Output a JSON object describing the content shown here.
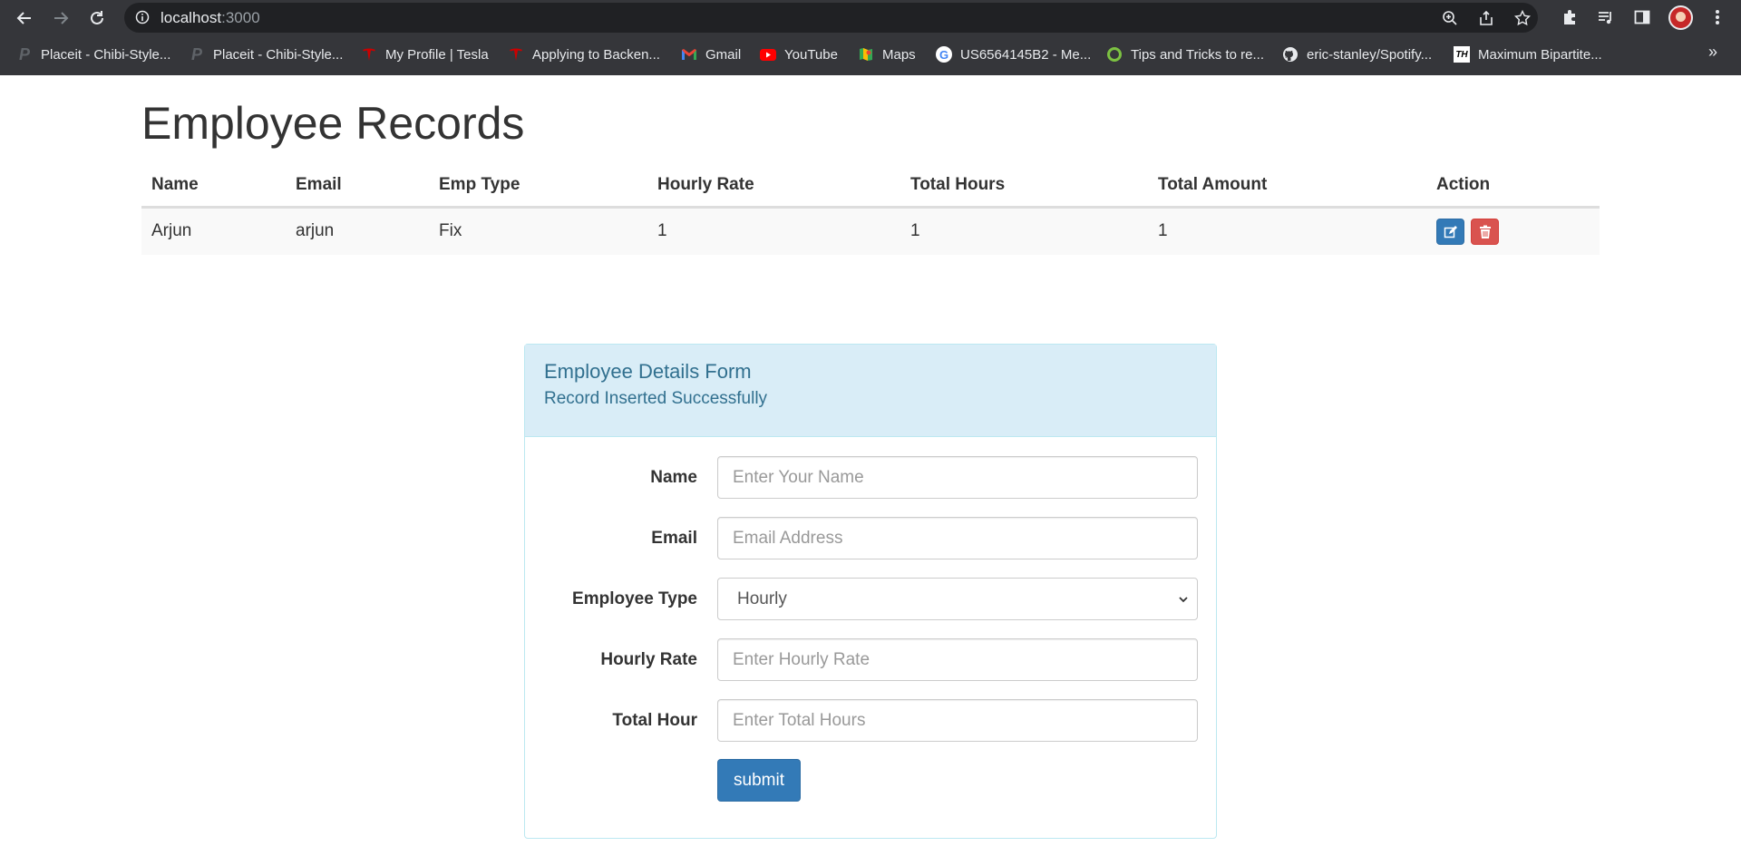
{
  "browser": {
    "url_host": "localhost",
    "url_port": ":3000",
    "bookmarks": [
      {
        "label": "Placeit - Chibi-Style...",
        "icon": "placeit-icon"
      },
      {
        "label": "Placeit - Chibi-Style...",
        "icon": "placeit-icon"
      },
      {
        "label": "My Profile | Tesla",
        "icon": "tesla-icon"
      },
      {
        "label": "Applying to Backen...",
        "icon": "tesla-icon"
      },
      {
        "label": "Gmail",
        "icon": "gmail-icon"
      },
      {
        "label": "YouTube",
        "icon": "youtube-icon"
      },
      {
        "label": "Maps",
        "icon": "maps-icon"
      },
      {
        "label": "US6564145B2 - Me...",
        "icon": "google-icon"
      },
      {
        "label": "Tips and Tricks to re...",
        "icon": "ring-icon"
      },
      {
        "label": "eric-stanley/Spotify...",
        "icon": "github-icon"
      },
      {
        "label": "Maximum Bipartite...",
        "icon": "th-icon"
      }
    ],
    "more_label": "»"
  },
  "page": {
    "title": "Employee Records",
    "table": {
      "headers": [
        "Name",
        "Email",
        "Emp Type",
        "Hourly Rate",
        "Total Hours",
        "Total Amount",
        "Action"
      ],
      "rows": [
        [
          "Arjun",
          "arjun",
          "Fix",
          "1",
          "1",
          "1"
        ]
      ]
    },
    "form": {
      "title": "Employee Details Form",
      "status": "Record Inserted Successfully",
      "fields": {
        "name": {
          "label": "Name",
          "placeholder": "Enter Your Name",
          "value": ""
        },
        "email": {
          "label": "Email",
          "placeholder": "Email Address",
          "value": ""
        },
        "type": {
          "label": "Employee Type",
          "selected": "Hourly"
        },
        "rate": {
          "label": "Hourly Rate",
          "placeholder": "Enter Hourly Rate",
          "value": ""
        },
        "hours": {
          "label": "Total Hour",
          "placeholder": "Enter Total Hours",
          "value": ""
        }
      },
      "submit_label": "submit"
    }
  },
  "colors": {
    "primary": "#337ab7",
    "danger": "#d9534f",
    "panel_heading_bg": "#d9edf7",
    "panel_heading_text": "#31708f",
    "chrome_bg": "#35363a"
  }
}
